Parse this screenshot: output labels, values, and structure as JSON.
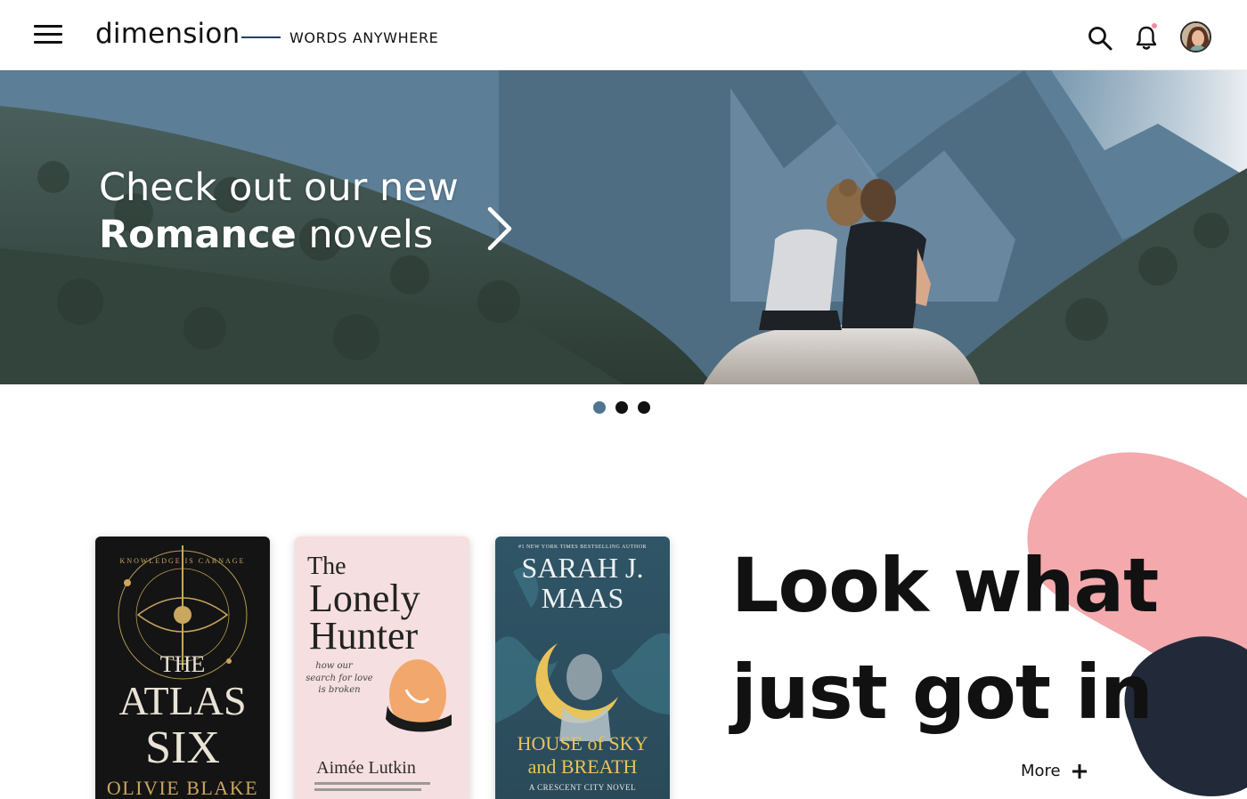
{
  "header": {
    "brand": "dimension",
    "tagline": "WORDS ANYWHERE",
    "menu_icon": "hamburger-menu-icon",
    "search_icon": "search-icon",
    "notification_icon": "bell-icon",
    "notification_dot_color": "#f48da0"
  },
  "hero": {
    "line1": "Check out our new",
    "line2_bold": "Romance",
    "line2_rest": " novels",
    "next_icon": "chevron-right-icon",
    "slides": 3,
    "active_slide": 1
  },
  "books": [
    {
      "top_label": "KNOWLEDGE IS CARNAGE",
      "title_line1": "THE",
      "title_line2": "ATLAS",
      "title_line3": "SIX",
      "author": "OLIVIE BLAKE"
    },
    {
      "title_line1": "The",
      "title_line2": "Lonely",
      "title_line3": "Hunter",
      "tagline_line1": "how our",
      "tagline_line2": "search for love",
      "tagline_line3": "is broken",
      "author": "Aimée Lutkin"
    },
    {
      "top_label": "#1 NEW YORK TIMES BESTSELLING AUTHOR",
      "author_line1": "SARAH J.",
      "author_line2": "MAAS",
      "title_line1": "HOUSE of SKY",
      "title_line2": "and BREATH",
      "series": "A CRESCENT CITY NOVEL"
    }
  ],
  "promo": {
    "line1": "Look what",
    "line2": "just got in",
    "more_label": "More",
    "more_icon": "plus-icon"
  },
  "colors": {
    "accent_blue": "#4e7592",
    "blob_pink": "#f4a9ad",
    "blob_navy": "#222a3a"
  }
}
